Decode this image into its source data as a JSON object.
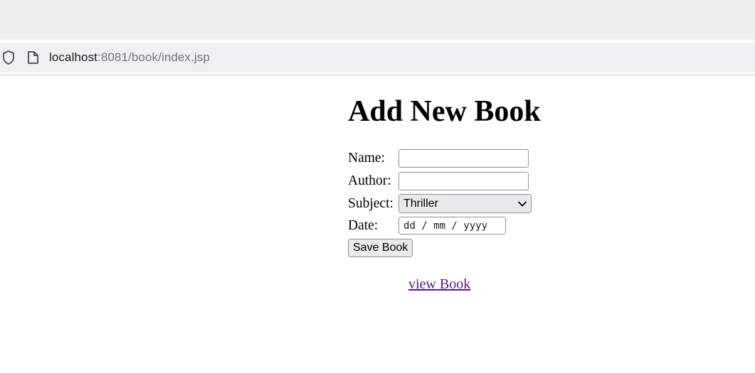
{
  "browser": {
    "url_host": "localhost",
    "url_rest": ":8081/book/index.jsp"
  },
  "page": {
    "title": "Add New Book",
    "form": {
      "name_label": "Name:",
      "name_value": "",
      "author_label": "Author:",
      "author_value": "",
      "subject_label": "Subject:",
      "subject_selected": "Thriller",
      "date_label": "Date:",
      "date_placeholder": "dd / mm / yyyy",
      "save_label": "Save Book"
    },
    "view_link": "view Book"
  },
  "icons": {
    "shield": "shield-icon",
    "page": "page-icon",
    "chevron": "chevron-down-icon"
  }
}
